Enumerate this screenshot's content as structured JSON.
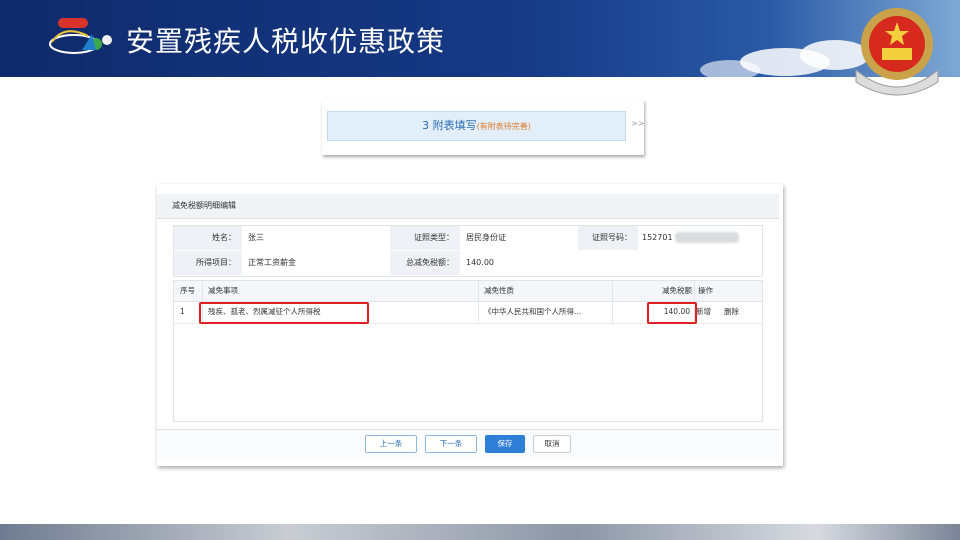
{
  "header": {
    "title": "安置残疾人税收优惠政策"
  },
  "step": {
    "label": "3 附表填写",
    "sub": "(有附表待完善)",
    "arrow": ">>"
  },
  "dialog": {
    "title": "减免税额明细编辑",
    "info": {
      "name_label": "姓名：",
      "name_value": "张三",
      "idtype_label": "证照类型：",
      "idtype_value": "居民身份证",
      "idno_label": "证照号码：",
      "idno_value": "152701",
      "item_label": "所得项目：",
      "item_value": "正常工资薪金",
      "total_label": "总减免税额：",
      "total_value": "140.00"
    },
    "table": {
      "headers": [
        "序号",
        "减免事项",
        "减免性质",
        "减免税额",
        "操作"
      ],
      "rows": [
        {
          "no": "1",
          "matter": "残疾、孤老、烈属减征个人所得税",
          "nature": "《中华人民共和国个人所得...",
          "amount": "140.00",
          "add": "新增",
          "del": "删除"
        }
      ]
    },
    "buttons": {
      "prev": "上一条",
      "next": "下一条",
      "save": "保存",
      "cancel": "取消"
    }
  }
}
